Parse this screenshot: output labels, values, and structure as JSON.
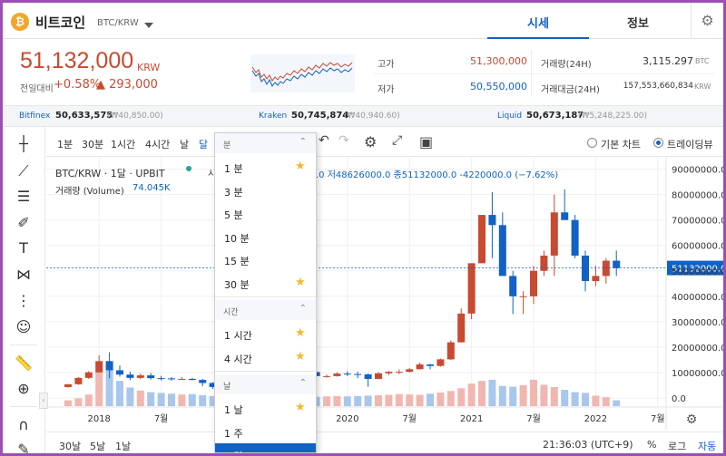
{
  "header": {
    "coin_symbol": "₿",
    "coin_name": "비트코인",
    "pair": "BTC/KRW",
    "tabs": [
      {
        "label": "시세",
        "active": true
      },
      {
        "label": "정보",
        "active": false
      }
    ]
  },
  "price": {
    "current": "51,132,000",
    "unit": "KRW",
    "change_label": "전일대비",
    "change_pct": "+0.58%",
    "change_abs": "▲ 293,000"
  },
  "stats": {
    "high_label": "고가",
    "high": "51,300,000",
    "low_label": "저가",
    "low": "50,550,000",
    "volume_label": "거래량(24H)",
    "volume": "3,115.297",
    "volume_unit": "BTC",
    "amount_label": "거래대금(24H)",
    "amount": "157,553,660,834",
    "amount_unit": "KRW"
  },
  "exchanges": [
    {
      "name": "Bitfinex",
      "price": "50,633,575",
      "diff": "(₩40,850.00)"
    },
    {
      "name": "Kraken",
      "price": "50,745,874",
      "diff": "(₩40,940.60)"
    },
    {
      "name": "Liquid",
      "price": "50,673,187",
      "diff": "(₩5,248,225.00)"
    }
  ],
  "chart_toolbar": {
    "intervals": [
      "1분",
      "30분",
      "1시간",
      "4시간",
      "날",
      "달"
    ],
    "radio_basic": "기본 차트",
    "radio_tv": "트레이딩뷰"
  },
  "legend": {
    "title": "BTC/KRW · 1달 · UPBIT",
    "title_suffix": "시",
    "volume_label": "거래량 (Volume)",
    "volume_value": "74.045K",
    "ohlc": ".0 저48626000.0 종51132000.0 -4220000.0 (−7.62%)"
  },
  "chart_data": {
    "type": "candlestick",
    "x_labels": [
      {
        "label": "2018",
        "i": 3
      },
      {
        "label": "7월",
        "i": 9
      },
      {
        "label": "2020",
        "i": 27
      },
      {
        "label": "7월",
        "i": 33
      },
      {
        "label": "2021",
        "i": 39
      },
      {
        "label": "7월",
        "i": 45
      },
      {
        "label": "2022",
        "i": 51
      },
      {
        "label": "7월",
        "i": 57
      }
    ],
    "y_ticks": [
      0,
      10000000,
      20000000,
      30000000,
      40000000,
      50000000,
      60000000,
      70000000,
      80000000,
      90000000
    ],
    "y_tick_labels": [
      "0.0",
      "10000000.0",
      "20000000.0",
      "30000000.0",
      "40000000.0",
      "50000000.0",
      "60000000.0",
      "70000000.0",
      "80000000.0",
      "90000000.0"
    ],
    "ylim": [
      0,
      92000000
    ],
    "last_price": 51132000,
    "last_price_label": "51132000.0",
    "up_color": "#c84a31",
    "down_color": "#1261c4",
    "candles": [
      [
        4.3,
        5.5,
        4.1,
        5.4
      ],
      [
        5.4,
        8.2,
        5.2,
        7.9
      ],
      [
        7.9,
        10.6,
        7.5,
        10.1
      ],
      [
        10.1,
        16.8,
        9.9,
        14.5
      ],
      [
        14.5,
        18.0,
        7.8,
        10.9
      ],
      [
        10.9,
        12.8,
        8.4,
        9.2
      ],
      [
        9.2,
        10.3,
        7.0,
        7.9
      ],
      [
        7.9,
        9.6,
        7.4,
        8.9
      ],
      [
        8.9,
        9.8,
        7.2,
        7.8
      ],
      [
        7.8,
        8.7,
        6.9,
        7.7
      ],
      [
        7.7,
        8.2,
        6.8,
        7.5
      ],
      [
        7.5,
        8.2,
        7.1,
        7.5
      ],
      [
        7.5,
        7.9,
        6.9,
        7.1
      ],
      [
        7.1,
        7.5,
        4.6,
        5.9
      ],
      [
        5.9,
        6.2,
        3.6,
        4.3
      ],
      [
        4.3,
        4.6,
        3.7,
        4.1
      ],
      [
        4.1,
        4.5,
        3.8,
        4.3
      ],
      [
        4.3,
        4.6,
        3.9,
        4.4
      ],
      [
        4.4,
        6.2,
        4.3,
        5.9
      ],
      [
        5.9,
        9.5,
        5.8,
        9.4
      ],
      [
        9.4,
        15.8,
        9.3,
        12.5
      ],
      [
        12.5,
        14.8,
        10.1,
        11.0
      ],
      [
        11.0,
        12.3,
        9.2,
        10.4
      ],
      [
        10.4,
        11.8,
        8.4,
        10.2
      ],
      [
        10.2,
        10.6,
        8.5,
        8.6
      ],
      [
        8.6,
        9.2,
        8.0,
        8.6
      ],
      [
        8.6,
        10.2,
        8.4,
        9.6
      ],
      [
        9.6,
        10.5,
        8.6,
        9.4
      ],
      [
        9.4,
        10.4,
        7.8,
        9.3
      ],
      [
        9.3,
        9.6,
        4.4,
        7.5
      ],
      [
        7.5,
        10.2,
        7.3,
        9.7
      ],
      [
        9.7,
        10.6,
        9.0,
        10.3
      ],
      [
        10.3,
        11.2,
        9.4,
        10.3
      ],
      [
        10.3,
        11.8,
        10.0,
        11.3
      ],
      [
        11.3,
        13.9,
        11.2,
        13.2
      ],
      [
        13.2,
        13.4,
        11.3,
        12.6
      ],
      [
        12.6,
        15.5,
        12.3,
        15.2
      ],
      [
        15.2,
        22.7,
        15.0,
        21.9
      ],
      [
        21.9,
        35.2,
        21.8,
        33.2
      ],
      [
        33.2,
        48.0,
        31.0,
        53.0
      ],
      [
        53.0,
        72.0,
        53.0,
        72.0
      ],
      [
        72.0,
        81.0,
        55.0,
        68.0
      ],
      [
        68.0,
        73.0,
        50.0,
        48.0
      ],
      [
        48.0,
        50.0,
        33.0,
        40.0
      ],
      [
        40.0,
        42.0,
        33.0,
        40.0
      ],
      [
        40.0,
        52.0,
        37.0,
        50.0
      ],
      [
        50.0,
        58.0,
        48.0,
        56.0
      ],
      [
        56.0,
        80.0,
        48.0,
        73.0
      ],
      [
        73.0,
        82.0,
        70.0,
        70.0
      ],
      [
        70.0,
        72.0,
        55.0,
        56.0
      ],
      [
        56.0,
        58.0,
        42.0,
        46.0
      ],
      [
        46.0,
        52.0,
        44.0,
        48.0
      ],
      [
        48.0,
        55.0,
        45.0,
        54.0
      ],
      [
        54.0,
        58.0,
        48.0,
        51.1
      ]
    ],
    "volumes": [
      1.5,
      2.0,
      3.0,
      9.5,
      10.8,
      6.5,
      4.8,
      4.0,
      3.6,
      3.4,
      3.2,
      3.0,
      3.1,
      2.8,
      2.6,
      2.4,
      2.5,
      2.2,
      2.8,
      3.0,
      3.3,
      3.0,
      2.9,
      2.7,
      2.4,
      2.5,
      2.6,
      2.5,
      2.6,
      2.7,
      2.8,
      2.9,
      3.1,
      3.0,
      2.9,
      3.2,
      3.5,
      3.9,
      4.6,
      5.8,
      6.5,
      6.8,
      5.2,
      5.0,
      5.4,
      6.8,
      5.5,
      4.9,
      4.2,
      3.6,
      3.4,
      2.7,
      2.3,
      1.5
    ]
  },
  "bottom_bar": {
    "ranges": [
      "30날",
      "5날",
      "1날"
    ],
    "time": "21:36:03 (UTC+9)",
    "pct": "%",
    "log": "로그",
    "auto": "자동"
  },
  "dropdown": {
    "sections": [
      {
        "label": "분",
        "items": [
          {
            "label": "1 분",
            "fav": true
          },
          {
            "label": "3 분",
            "fav": false
          },
          {
            "label": "5 분",
            "fav": false
          },
          {
            "label": "10 분",
            "fav": false
          },
          {
            "label": "15 분",
            "fav": false
          },
          {
            "label": "30 분",
            "fav": true
          }
        ]
      },
      {
        "label": "시간",
        "items": [
          {
            "label": "1 시간",
            "fav": true
          },
          {
            "label": "4 시간",
            "fav": true
          }
        ]
      },
      {
        "label": "날",
        "items": [
          {
            "label": "1 날",
            "fav": true
          },
          {
            "label": "1 주",
            "fav": false
          },
          {
            "label": "1 달",
            "fav": false,
            "selected": true
          }
        ]
      }
    ]
  }
}
